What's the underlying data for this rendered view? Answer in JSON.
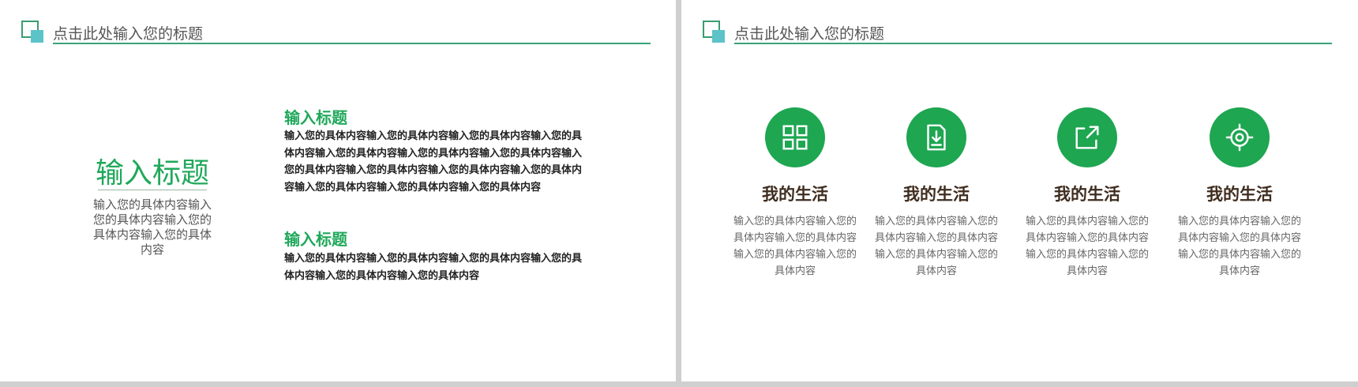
{
  "left_slide": {
    "header_title": "点击此处输入您的标题",
    "big_title": "输入标题",
    "big_description": "输入您的具体内容输入您的具体内容输入您的具体内容输入您的具体内容",
    "sections": [
      {
        "title": "输入标题",
        "body": "输入您的具体内容输入您的具体内容输入您的具体内容输入您的具体内容输入您的具体内容输入您的具体内容输入您的具体内容输入您的具体内容输入您的具体内容输入您的具体内容输入您的具体内容输入您的具体内容输入您的具体内容输入您的具体内容"
      },
      {
        "title": "输入标题",
        "body": "输入您的具体内容输入您的具体内容输入您的具体内容输入您的具体内容输入您的具体内容输入您的具体内容"
      }
    ]
  },
  "right_slide": {
    "header_title": "点击此处输入您的标题",
    "features": [
      {
        "icon": "grid-icon",
        "title": "我的生活",
        "description": "输入您的具体内容输入您的具体内容输入您的具体内容输入您的具体内容输入您的具体内容"
      },
      {
        "icon": "download-file-icon",
        "title": "我的生活",
        "description": "输入您的具体内容输入您的具体内容输入您的具体内容输入您的具体内容输入您的具体内容"
      },
      {
        "icon": "share-export-icon",
        "title": "我的生活",
        "description": "输入您的具体内容输入您的具体内容输入您的具体内容输入您的具体内容输入您的具体内容"
      },
      {
        "icon": "gear-icon",
        "title": "我的生活",
        "description": "输入您的具体内容输入您的具体内容输入您的具体内容输入您的具体内容输入您的具体内容"
      }
    ]
  },
  "colors": {
    "accent_green": "#1ea651",
    "header_line": "#3aa37a",
    "logo_teal": "#5cc3c9",
    "feature_title": "#3f2d1f"
  }
}
